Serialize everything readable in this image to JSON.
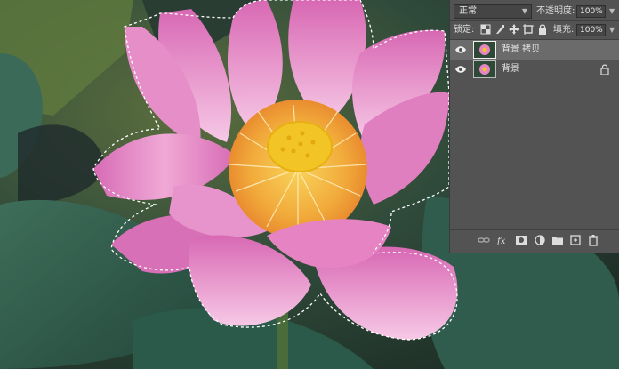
{
  "layers_panel": {
    "blend_mode": "正常",
    "opacity_label": "不透明度:",
    "opacity_value": "100%",
    "lock_label": "锁定:",
    "fill_label": "填充:",
    "fill_value": "100%",
    "layers": [
      {
        "name": "背景 拷贝",
        "selected": true,
        "visible": true,
        "locked": false
      },
      {
        "name": "背景",
        "selected": false,
        "visible": true,
        "locked": true
      }
    ],
    "bottom_icons": [
      "link-layers-icon",
      "fx-icon",
      "layer-mask-icon",
      "adjustment-layer-icon",
      "new-group-icon",
      "new-layer-icon",
      "delete-layer-icon"
    ]
  },
  "canvas": {
    "subject": "pink lotus flower with active selection",
    "colors": {
      "petal": "#e07fc0",
      "petal_light": "#f4b5df",
      "center": "#f3c22a",
      "leaf": "#2f5a48",
      "bg_dark": "#1e3128"
    }
  }
}
